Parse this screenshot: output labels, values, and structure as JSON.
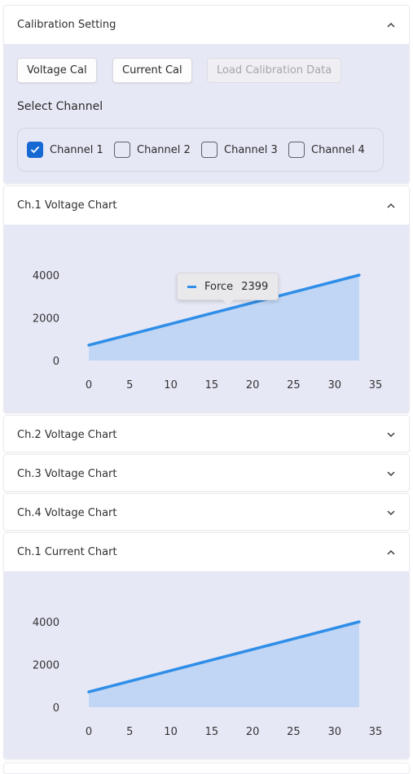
{
  "colors": {
    "accent": "#1669d3",
    "series_line": "#2f8ee8",
    "series_fill": "#c0d6f4",
    "panel_body": "#e7e8f6"
  },
  "calibration": {
    "title": "Calibration Setting",
    "voltage_cal": "Voltage Cal",
    "current_cal": "Current Cal",
    "load_data": "Load Calibration Data",
    "select_channel": "Select Channel",
    "channels": [
      {
        "label": "Channel 1",
        "checked": true
      },
      {
        "label": "Channel 2",
        "checked": false
      },
      {
        "label": "Channel 3",
        "checked": false
      },
      {
        "label": "Channel 4",
        "checked": false
      }
    ]
  },
  "panels": {
    "ch1_voltage": "Ch.1 Voltage Chart",
    "ch2_voltage": "Ch.2 Voltage Chart",
    "ch3_voltage": "Ch.3 Voltage Chart",
    "ch4_voltage": "Ch.4 Voltage Chart",
    "ch1_current": "Ch.1 Current Chart"
  },
  "tooltip": {
    "series": "Force",
    "value": "2399"
  },
  "chart_data": [
    {
      "type": "area",
      "series": [
        {
          "name": "Force",
          "x": [
            0,
            33
          ],
          "values": [
            720,
            4000
          ]
        }
      ],
      "x_ticks": [
        "0",
        "5",
        "10",
        "15",
        "20",
        "25",
        "30",
        "35"
      ],
      "y_ticks": [
        "0",
        "2000",
        "4000"
      ],
      "xlim": [
        0,
        35
      ],
      "ylim": [
        0,
        4000
      ],
      "grid": false,
      "tooltip": {
        "series": "Force",
        "x": 17,
        "value": 2399
      }
    },
    {
      "type": "area",
      "series": [
        {
          "name": "Force",
          "x": [
            0,
            33
          ],
          "values": [
            720,
            4000
          ]
        }
      ],
      "x_ticks": [
        "0",
        "5",
        "10",
        "15",
        "20",
        "25",
        "30",
        "35"
      ],
      "y_ticks": [
        "0",
        "2000",
        "4000"
      ],
      "xlim": [
        0,
        35
      ],
      "ylim": [
        0,
        4000
      ],
      "grid": false
    }
  ]
}
